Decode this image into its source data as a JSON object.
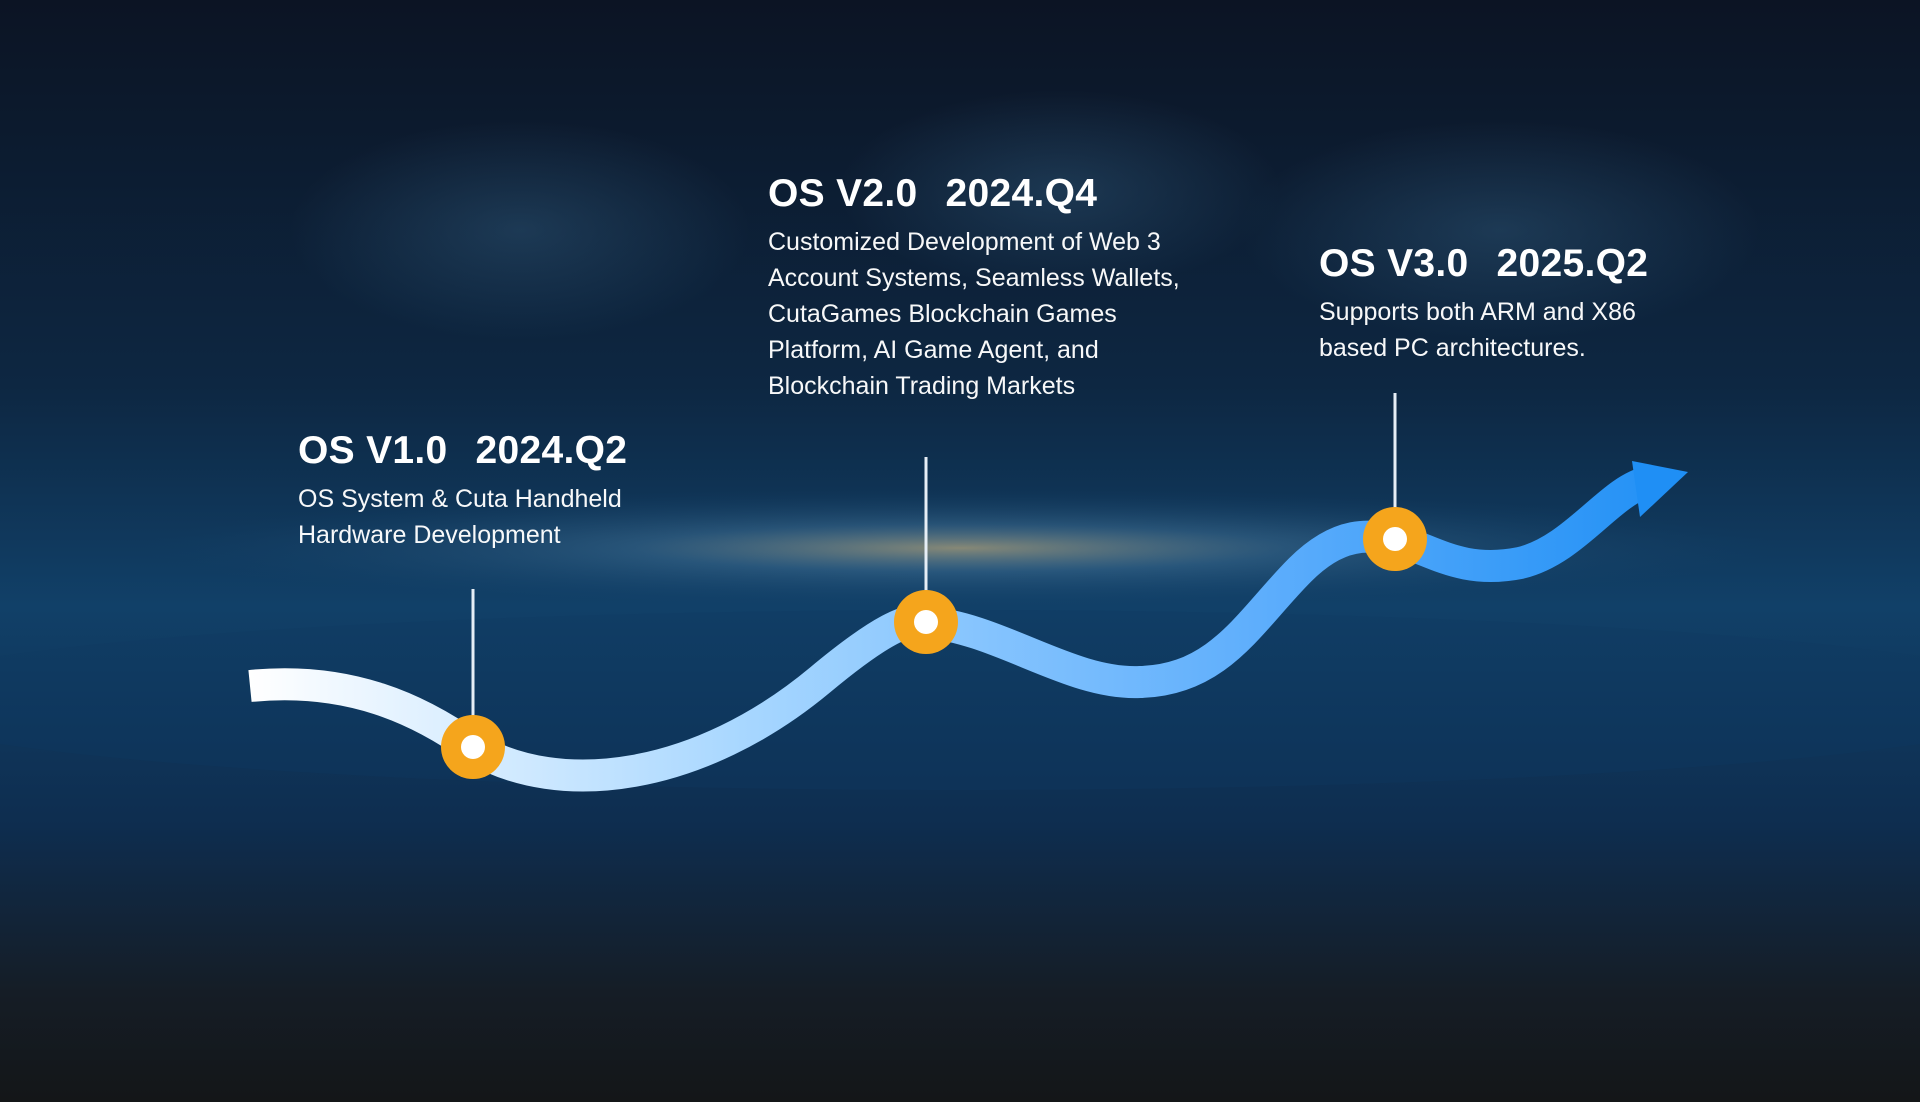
{
  "colors": {
    "background_top": "#0c1424",
    "background_mid": "#103459",
    "background_bottom": "#141618",
    "curve_start": "#ffffff",
    "curve_end": "#1f8ff5",
    "marker": "#f5a51c",
    "marker_center": "#ffffff",
    "text": "#ffffff"
  },
  "icons": {
    "marker": "circle-marker-icon",
    "arrow": "arrow-head-icon"
  },
  "milestones": [
    {
      "version": "OS V1.0",
      "date": "2024.Q2",
      "description": [
        "OS System & Cuta Handheld",
        "Hardware Development"
      ]
    },
    {
      "version": "OS V2.0",
      "date": "2024.Q4",
      "description": [
        "Customized Development of Web 3",
        "Account Systems, Seamless Wallets,",
        "CutaGames Blockchain Games",
        "Platform, AI Game Agent, and",
        "Blockchain Trading Markets"
      ]
    },
    {
      "version": "OS V3.0",
      "date": "2025.Q2",
      "description": [
        "Supports both ARM and X86",
        "based PC architectures."
      ]
    }
  ]
}
